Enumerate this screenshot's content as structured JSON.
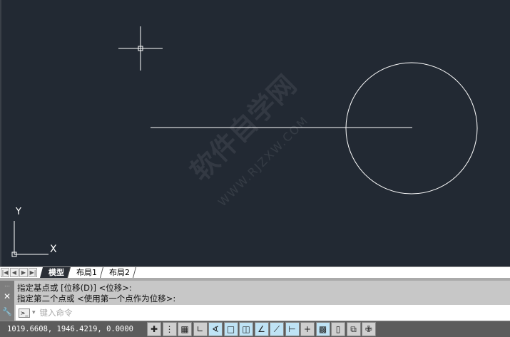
{
  "watermark": {
    "text": "软件自学网",
    "url_text": "WWW.RJZXW.COM"
  },
  "ucs": {
    "x_label": "X",
    "y_label": "Y"
  },
  "tabs": {
    "nav": [
      "|◀",
      "◀",
      "▶",
      "▶|"
    ],
    "items": [
      "模型",
      "布局1",
      "布局2"
    ]
  },
  "command": {
    "history": [
      "指定基点或 [位移(D)] <位移>:",
      "指定第二个点或 <使用第一个点作为位移>:"
    ],
    "close_glyph": "✕",
    "settings_glyph": "🔧",
    "prompt_glyph": ">_",
    "dropdown_glyph": "▾",
    "placeholder": "键入命令"
  },
  "status": {
    "coords": "1019.6608, 1946.4219, 0.0000",
    "buttons": [
      {
        "name": "infer-constraints",
        "glyph": "✚",
        "on": false
      },
      {
        "name": "snap-mode",
        "glyph": "⋮",
        "on": false
      },
      {
        "name": "grid-display",
        "glyph": "▦",
        "on": false
      },
      {
        "name": "ortho-mode",
        "glyph": "∟",
        "on": false
      },
      {
        "name": "polar-tracking",
        "glyph": "∢",
        "on": true
      },
      {
        "name": "object-snap",
        "glyph": "□",
        "on": true
      },
      {
        "name": "3d-object-snap",
        "glyph": "◫",
        "on": true
      },
      {
        "name": "object-snap-tracking",
        "glyph": "∠",
        "on": true
      },
      {
        "name": "dynamic-ucs",
        "glyph": "⟋",
        "on": true
      },
      {
        "name": "dynamic-input",
        "glyph": "⊢",
        "on": true
      },
      {
        "name": "lineweight",
        "glyph": "+",
        "on": false
      },
      {
        "name": "transparency",
        "glyph": "▩",
        "on": true
      },
      {
        "name": "quick-properties",
        "glyph": "▯",
        "on": false
      },
      {
        "name": "selection-cycling",
        "glyph": "⧉",
        "on": false
      },
      {
        "name": "annotation-monitor",
        "glyph": "✙",
        "on": false
      }
    ]
  }
}
